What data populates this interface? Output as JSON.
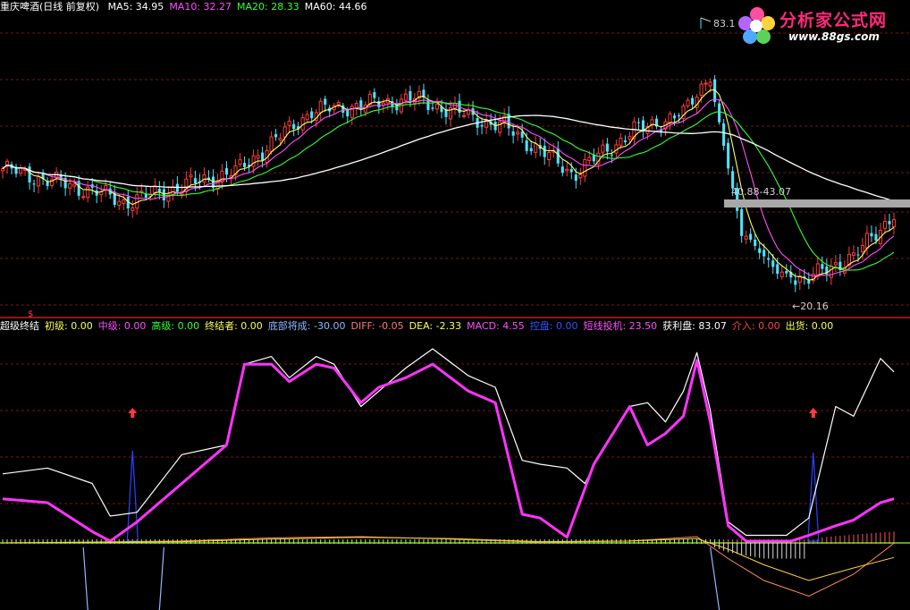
{
  "header_top": {
    "stock_label": "重庆啤酒(日线 前复权)",
    "ma": [
      {
        "text": "MA5: 34.95",
        "color": "#ffffff"
      },
      {
        "text": "MA10: 32.27",
        "color": "#ff4fff"
      },
      {
        "text": "MA20: 28.33",
        "color": "#33ff33"
      },
      {
        "text": "MA60: 44.66",
        "color": "#ffffff"
      }
    ]
  },
  "header_bottom": {
    "items": [
      {
        "text": "超级终结",
        "color": "#ffffff"
      },
      {
        "text": "初级: 0.00",
        "color": "#ffff55"
      },
      {
        "text": "中级: 0.00",
        "color": "#ff4fff"
      },
      {
        "text": "高级: 0.00",
        "color": "#33ff33"
      },
      {
        "text": "终结者: 0.00",
        "color": "#ffff55"
      },
      {
        "text": "底部将成: -30.00",
        "color": "#8fb8ff"
      },
      {
        "text": "DIFF: -0.05",
        "color": "#ff7777"
      },
      {
        "text": "DEA: -2.33",
        "color": "#ffff55"
      },
      {
        "text": "MACD: 4.55",
        "color": "#ff4fff"
      },
      {
        "text": "控盘: 0.00",
        "color": "#3355ff"
      },
      {
        "text": "短线投机: 23.50",
        "color": "#ff4fff"
      },
      {
        "text": "获利盘: 83.07",
        "color": "#ffffff"
      },
      {
        "text": "介入: 0.00",
        "color": "#ff4444"
      },
      {
        "text": "出货: 0.00",
        "color": "#ffff55"
      }
    ]
  },
  "logo": {
    "title": "分析家公式网",
    "url": "www.88gs.com"
  },
  "chart_data": [
    {
      "type": "candlestick",
      "y_range": [
        14,
        88
      ],
      "annotations": [
        {
          "text": "83.1",
          "index": 155,
          "value": 83.1
        },
        {
          "text": "40.88-43.07",
          "index": 163,
          "value": 42.0
        },
        {
          "text": "←20.16",
          "index": 177,
          "value": 20.16
        }
      ],
      "segments": [
        {
          "from": 0,
          "count": 18,
          "start": 49.0,
          "end": 44.0
        },
        {
          "from": 18,
          "count": 10,
          "start": 44.0,
          "end": 40.5
        },
        {
          "from": 28,
          "count": 24,
          "start": 40.5,
          "end": 48.0
        },
        {
          "from": 52,
          "count": 18,
          "start": 48.0,
          "end": 64.0
        },
        {
          "from": 70,
          "count": 22,
          "start": 64.0,
          "end": 67.0
        },
        {
          "from": 92,
          "count": 20,
          "start": 67.0,
          "end": 60.0
        },
        {
          "from": 112,
          "count": 16,
          "start": 60.0,
          "end": 48.0
        },
        {
          "from": 128,
          "count": 14,
          "start": 48.0,
          "end": 59.0
        },
        {
          "from": 142,
          "count": 10,
          "start": 59.0,
          "end": 63.0
        },
        {
          "from": 152,
          "count": 6,
          "start": 63.0,
          "end": 72.0
        },
        {
          "from": 158,
          "count": 8,
          "start": 72.0,
          "end": 32.0
        },
        {
          "from": 166,
          "count": 8,
          "start": 32.0,
          "end": 22.0
        },
        {
          "from": 174,
          "count": 6,
          "start": 22.0,
          "end": 20.5
        },
        {
          "from": 180,
          "count": 10,
          "start": 20.5,
          "end": 26.0
        },
        {
          "from": 190,
          "count": 10,
          "start": 26.0,
          "end": 37.5
        }
      ],
      "ma_periods": [
        5,
        10,
        20,
        60
      ]
    },
    {
      "type": "line",
      "y_range": [
        0,
        100
      ],
      "signal_arrows": [
        {
          "index": 29
        },
        {
          "index": 181
        }
      ],
      "series": [
        {
          "key": "white",
          "color": "#ffffff",
          "points": [
            [
              0,
              35
            ],
            [
              10,
              38
            ],
            [
              20,
              30
            ],
            [
              24,
              13
            ],
            [
              30,
              15
            ],
            [
              40,
              45
            ],
            [
              50,
              50
            ],
            [
              54,
              92
            ],
            [
              60,
              96
            ],
            [
              64,
              85
            ],
            [
              70,
              96
            ],
            [
              74,
              92
            ],
            [
              80,
              70
            ],
            [
              84,
              78
            ],
            [
              90,
              90
            ],
            [
              96,
              100
            ],
            [
              104,
              86
            ],
            [
              110,
              80
            ],
            [
              116,
              42
            ],
            [
              120,
              40
            ],
            [
              126,
              38
            ],
            [
              130,
              30
            ],
            [
              134,
              48
            ],
            [
              140,
              70
            ],
            [
              144,
              72
            ],
            [
              148,
              62
            ],
            [
              152,
              78
            ],
            [
              155,
              98
            ],
            [
              158,
              68
            ],
            [
              162,
              10
            ],
            [
              166,
              3
            ],
            [
              175,
              3
            ],
            [
              180,
              12
            ],
            [
              186,
              70
            ],
            [
              190,
              65
            ],
            [
              196,
              95
            ],
            [
              199,
              88
            ]
          ]
        },
        {
          "key": "magenta",
          "color": "#ff33ff",
          "points": [
            [
              0,
              22
            ],
            [
              10,
              20
            ],
            [
              20,
              5
            ],
            [
              24,
              0
            ],
            [
              30,
              10
            ],
            [
              40,
              30
            ],
            [
              50,
              50
            ],
            [
              54,
              92
            ],
            [
              60,
              92
            ],
            [
              64,
              83
            ],
            [
              70,
              92
            ],
            [
              74,
              90
            ],
            [
              80,
              72
            ],
            [
              84,
              80
            ],
            [
              90,
              85
            ],
            [
              96,
              92
            ],
            [
              104,
              78
            ],
            [
              110,
              72
            ],
            [
              116,
              14
            ],
            [
              120,
              12
            ],
            [
              126,
              2
            ],
            [
              132,
              40
            ],
            [
              140,
              70
            ],
            [
              144,
              50
            ],
            [
              148,
              56
            ],
            [
              152,
              65
            ],
            [
              155,
              94
            ],
            [
              158,
              62
            ],
            [
              162,
              8
            ],
            [
              166,
              0
            ],
            [
              176,
              0
            ],
            [
              180,
              3
            ],
            [
              186,
              8
            ],
            [
              190,
              11
            ],
            [
              196,
              20
            ],
            [
              199,
              22
            ]
          ]
        }
      ],
      "spikes": [
        {
          "index": 29,
          "value": 47
        },
        {
          "index": 181,
          "value": 46
        }
      ]
    },
    {
      "type": "macd",
      "diff": [
        [
          0,
          0
        ],
        [
          40,
          0.3
        ],
        [
          60,
          0.8
        ],
        [
          80,
          1.0
        ],
        [
          100,
          0.6
        ],
        [
          120,
          0.1
        ],
        [
          140,
          0.3
        ],
        [
          155,
          1.0
        ],
        [
          162,
          -2.5
        ],
        [
          170,
          -6
        ],
        [
          180,
          -8.5
        ],
        [
          190,
          -5
        ],
        [
          199,
          -0.05
        ]
      ],
      "dea": [
        [
          0,
          0
        ],
        [
          40,
          0.2
        ],
        [
          60,
          0.6
        ],
        [
          80,
          0.9
        ],
        [
          100,
          0.7
        ],
        [
          120,
          0.2
        ],
        [
          140,
          0.3
        ],
        [
          155,
          0.7
        ],
        [
          162,
          -1
        ],
        [
          170,
          -3.5
        ],
        [
          180,
          -6
        ],
        [
          190,
          -4
        ],
        [
          199,
          -2.33
        ]
      ],
      "y_range": [
        -10,
        3
      ]
    }
  ]
}
